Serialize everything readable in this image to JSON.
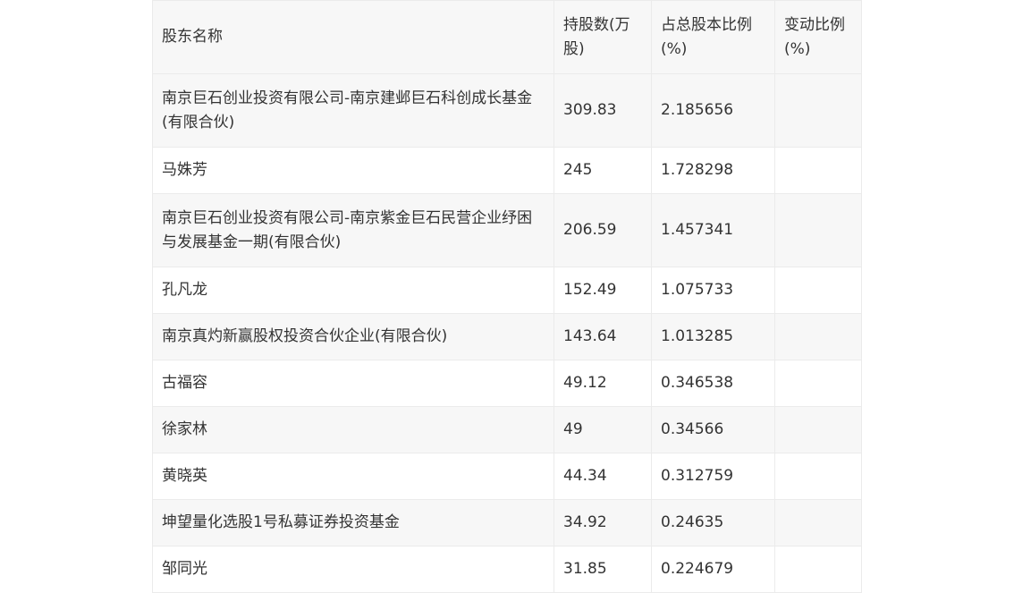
{
  "table": {
    "headers": [
      "股东名称",
      "持股数(万股)",
      "占总股本比例(%)",
      "变动比例(%)"
    ],
    "rows": [
      [
        "南京巨石创业投资有限公司-南京建邺巨石科创成长基金(有限合伙)",
        "309.83",
        "2.185656",
        ""
      ],
      [
        "马姝芳",
        "245",
        "1.728298",
        ""
      ],
      [
        "南京巨石创业投资有限公司-南京紫金巨石民营企业纾困与发展基金一期(有限合伙)",
        "206.59",
        "1.457341",
        ""
      ],
      [
        "孔凡龙",
        "152.49",
        "1.075733",
        ""
      ],
      [
        "南京真灼新赢股权投资合伙企业(有限合伙)",
        "143.64",
        "1.013285",
        ""
      ],
      [
        "古福容",
        "49.12",
        "0.346538",
        ""
      ],
      [
        "徐家林",
        "49",
        "0.34566",
        ""
      ],
      [
        "黄晓英",
        "44.34",
        "0.312759",
        ""
      ],
      [
        "坤望量化选股1号私募证券投资基金",
        "34.92",
        "0.24635",
        ""
      ],
      [
        "邹同光",
        "31.85",
        "0.224679",
        ""
      ]
    ]
  }
}
